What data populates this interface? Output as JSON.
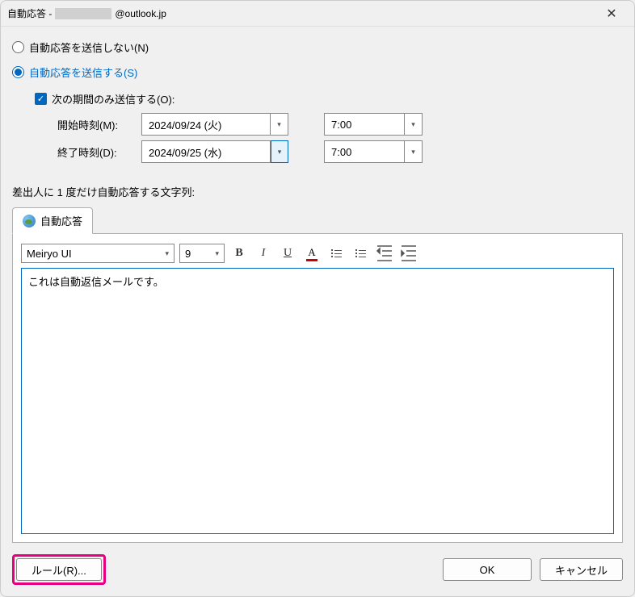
{
  "titlebar": {
    "prefix": "自動応答 - ",
    "email_suffix": "@outlook.jp"
  },
  "radios": {
    "dont_send": "自動応答を送信しない(N)",
    "send": "自動応答を送信する(S)"
  },
  "period": {
    "checkbox_label": "次の期間のみ送信する(O):",
    "start_label": "開始時刻(M):",
    "end_label": "終了時刻(D):",
    "start_date": "2024/09/24 (火)",
    "start_time": "7:00",
    "end_date": "2024/09/25 (水)",
    "end_time": "7:00"
  },
  "section_label": "差出人に 1 度だけ自動応答する文字列:",
  "tab": {
    "label": "自動応答"
  },
  "toolbar": {
    "font": "Meiryo UI",
    "size": "9"
  },
  "editor": {
    "text": "これは自動返信メールです。"
  },
  "buttons": {
    "rules": "ルール(R)...",
    "ok": "OK",
    "cancel": "キャンセル"
  }
}
